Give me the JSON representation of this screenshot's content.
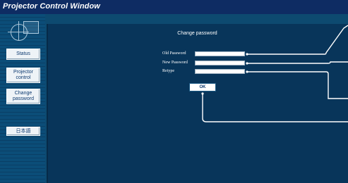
{
  "window": {
    "title": "Projector Control Window"
  },
  "sidebar": {
    "logo_icon": "projector-logo-icon",
    "buttons": [
      {
        "lines": [
          "Status"
        ]
      },
      {
        "lines": [
          "Projector",
          "control"
        ]
      },
      {
        "lines": [
          "Change",
          "password"
        ]
      },
      {
        "lines": [
          "日本語"
        ]
      }
    ]
  },
  "main": {
    "title": "Change password",
    "fields": [
      {
        "label": "Old Password",
        "value": ""
      },
      {
        "label": "New Password",
        "value": ""
      },
      {
        "label": "Retype",
        "value": ""
      }
    ],
    "ok_label": "OK"
  },
  "colors": {
    "titlebar": "#0e2c63",
    "panel": "#08355a",
    "sidebar": "#0b4d78",
    "callout": "#ffffff"
  }
}
